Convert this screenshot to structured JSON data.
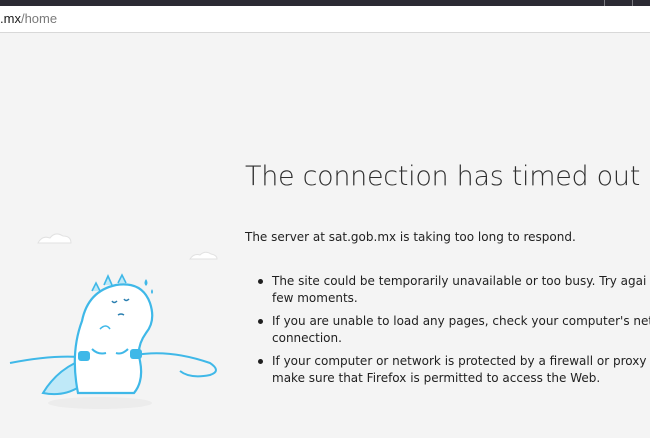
{
  "browser": {
    "url_host": ".mx",
    "url_path": "/home"
  },
  "error": {
    "title": "The connection has timed out",
    "subtitle": "The server at sat.gob.mx is taking too long to respond.",
    "reasons": [
      [
        "The site could be temporarily unavailable or too busy. Try agai",
        "few moments."
      ],
      [
        "If you are unable to load any pages, check your computer's net",
        "connection."
      ],
      [
        "If your computer or network is protected by a firewall or proxy",
        "make sure that Firefox is permitted to access the Web."
      ]
    ]
  },
  "illustration": {
    "icon": "timed-out-dino-illustration",
    "accent_color": "#3fb8e8"
  }
}
